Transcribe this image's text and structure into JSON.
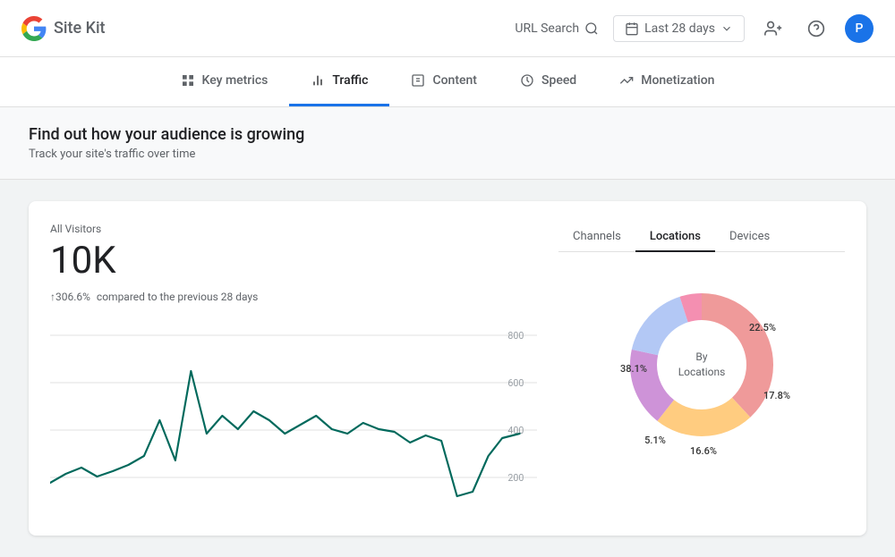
{
  "header": {
    "logo_text": "Site Kit",
    "url_search_label": "URL Search",
    "date_range_label": "Last 28 days",
    "avatar_letter": "P"
  },
  "nav": {
    "items": [
      {
        "id": "key-metrics",
        "label": "Key metrics",
        "icon": "grid-icon",
        "active": false
      },
      {
        "id": "traffic",
        "label": "Traffic",
        "icon": "bar-chart-icon",
        "active": true
      },
      {
        "id": "content",
        "label": "Content",
        "icon": "content-icon",
        "active": false
      },
      {
        "id": "speed",
        "label": "Speed",
        "icon": "speed-icon",
        "active": false
      },
      {
        "id": "monetization",
        "label": "Monetization",
        "icon": "monetization-icon",
        "active": false
      }
    ]
  },
  "banner": {
    "title": "Find out how your audience is growing",
    "subtitle": "Track your site's traffic over time"
  },
  "card": {
    "metric": {
      "label": "All Visitors",
      "value": "10K",
      "change_prefix": "↑306.6%",
      "change_suffix": "compared to the previous 28 days"
    },
    "chart": {
      "y_labels": [
        "800",
        "600",
        "400",
        "200"
      ],
      "color": "#00695c"
    },
    "donut": {
      "tabs": [
        "Channels",
        "Locations",
        "Devices"
      ],
      "active_tab": "Locations",
      "center_label": "By\nLocations",
      "segments": [
        {
          "label": "38.1%",
          "color": "#ef9a9a",
          "pct": 38.1
        },
        {
          "label": "22.5%",
          "color": "#ffcc80",
          "pct": 22.5
        },
        {
          "label": "17.8%",
          "color": "#ce93d8",
          "pct": 17.8
        },
        {
          "label": "16.6%",
          "color": "#b3c8f5",
          "pct": 16.6
        },
        {
          "label": "5.1%",
          "color": "#f48fb1",
          "pct": 5.1
        }
      ]
    }
  }
}
